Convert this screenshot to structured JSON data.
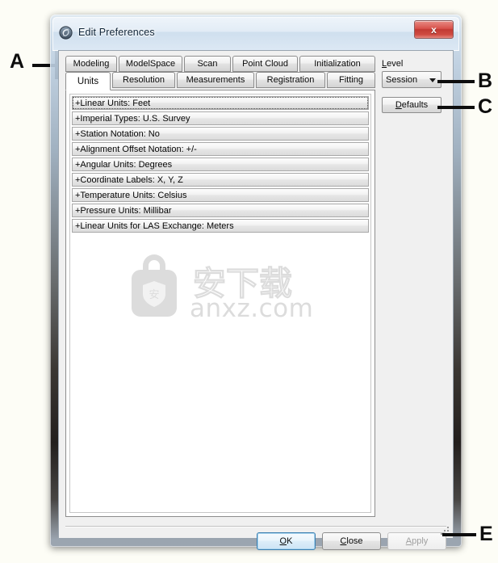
{
  "window": {
    "title": "Edit Preferences",
    "app_icon": "swirl-icon",
    "close_label": "x"
  },
  "tabs": {
    "row1": [
      {
        "label": "Modeling",
        "selected": false
      },
      {
        "label": "ModelSpace",
        "selected": false
      },
      {
        "label": "Scan",
        "selected": false
      },
      {
        "label": "Point Cloud",
        "selected": false
      },
      {
        "label": "Initialization",
        "selected": false
      }
    ],
    "row2": [
      {
        "label": "Units",
        "selected": true
      },
      {
        "label": "Resolution",
        "selected": false
      },
      {
        "label": "Measurements",
        "selected": false
      },
      {
        "label": "Registration",
        "selected": false
      },
      {
        "label": "Fitting",
        "selected": false
      }
    ]
  },
  "preferences": [
    {
      "label": "+Linear Units: Feet",
      "focused": true
    },
    {
      "label": "+Imperial Types: U.S. Survey",
      "focused": false
    },
    {
      "label": "+Station Notation: No",
      "focused": false
    },
    {
      "label": "+Alignment Offset Notation: +/-",
      "focused": false
    },
    {
      "label": "+Angular Units: Degrees",
      "focused": false
    },
    {
      "label": "+Coordinate Labels: X, Y, Z",
      "focused": false
    },
    {
      "label": "+Temperature Units: Celsius",
      "focused": false
    },
    {
      "label": "+Pressure Units: Millibar",
      "focused": false
    },
    {
      "label": "+Linear Units for LAS Exchange: Meters",
      "focused": false
    }
  ],
  "right_panel": {
    "level_label": "Level",
    "level_accel": "L",
    "level_value": "Session",
    "level_options": [
      "Session"
    ],
    "defaults_label": "Defaults",
    "defaults_accel": "D"
  },
  "footer": {
    "ok_label": "OK",
    "ok_accel": "O",
    "close_label": "Close",
    "close_accel": "C",
    "apply_label": "Apply",
    "apply_accel": "A",
    "apply_disabled": true
  },
  "watermark": {
    "site": "anxz.com",
    "glyphs": "安下载"
  },
  "callouts": [
    {
      "letter": "A"
    },
    {
      "letter": "B"
    },
    {
      "letter": "C"
    },
    {
      "letter": "E"
    }
  ],
  "colors": {
    "close_button": "#c23a33",
    "default_button_border": "#3c7fb1",
    "dialog_face": "#f0f0f0",
    "selected_tab": "#ffffff",
    "watermark": "#dcdcdc"
  }
}
